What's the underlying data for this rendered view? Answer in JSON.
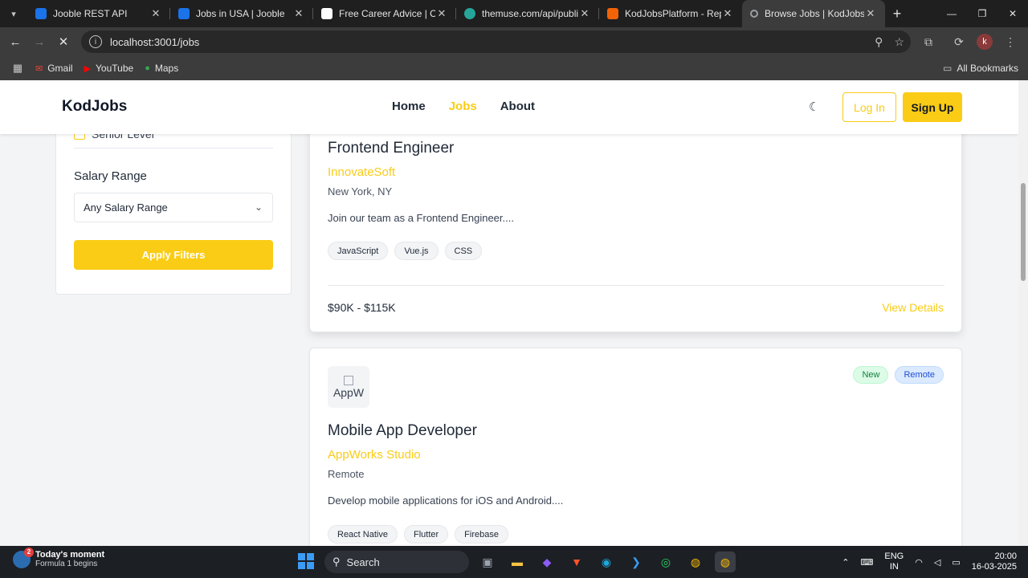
{
  "browser": {
    "tabs": [
      {
        "title": "Jooble REST API",
        "favicon_color": "#1a73e8",
        "active": false
      },
      {
        "title": "Jobs in USA | Jooble",
        "favicon_color": "#1a73e8",
        "active": false
      },
      {
        "title": "Free Career Advice | Caree",
        "favicon_color": "#ffffff",
        "active": false
      },
      {
        "title": "themuse.com/api/public/jo",
        "favicon_color": "#26a69a",
        "active": false
      },
      {
        "title": "KodJobsPlatform - Replit",
        "favicon_color": "#f26207",
        "active": false
      },
      {
        "title": "Browse Jobs | KodJobs",
        "favicon_color": "#9aa0a6",
        "active": true
      }
    ],
    "url": "localhost:3001/jobs",
    "bookmarks": [
      {
        "label": "Gmail",
        "icon": "gmail-icon",
        "color": "#ea4335"
      },
      {
        "label": "YouTube",
        "icon": "youtube-icon",
        "color": "#ff0000"
      },
      {
        "label": "Maps",
        "icon": "maps-icon",
        "color": "#34a853"
      }
    ],
    "all_bookmarks": "All Bookmarks",
    "profile_initial": "k"
  },
  "site": {
    "brand": "KodJobs",
    "nav": [
      "Home",
      "Jobs",
      "About"
    ],
    "active_nav": "Jobs",
    "login": "Log In",
    "signup": "Sign Up",
    "accent": "#facc15"
  },
  "filters": {
    "checkbox_label": "Senior Level",
    "salary_label": "Salary Range",
    "salary_select": "Any Salary Range",
    "apply_label": "Apply Filters"
  },
  "jobs": [
    {
      "title": "Frontend Engineer",
      "company": "InnovateSoft",
      "location": "New York, NY",
      "description": "Join our team as a Frontend Engineer....",
      "tags": [
        "JavaScript",
        "Vue.js",
        "CSS"
      ],
      "salary": "$90K - $115K",
      "details_label": "View Details"
    },
    {
      "logo_alt": "AppW",
      "badges": [
        "New",
        "Remote"
      ],
      "title": "Mobile App Developer",
      "company": "AppWorks Studio",
      "location": "Remote",
      "description": "Develop mobile applications for iOS and Android....",
      "tags": [
        "React Native",
        "Flutter",
        "Firebase"
      ]
    }
  ],
  "taskbar": {
    "moment_title": "Today's moment",
    "moment_sub": "Formula 1 begins",
    "moment_badge": "2",
    "search": "Search",
    "lang1": "ENG",
    "lang2": "IN",
    "time": "20:00",
    "date": "16-03-2025"
  }
}
